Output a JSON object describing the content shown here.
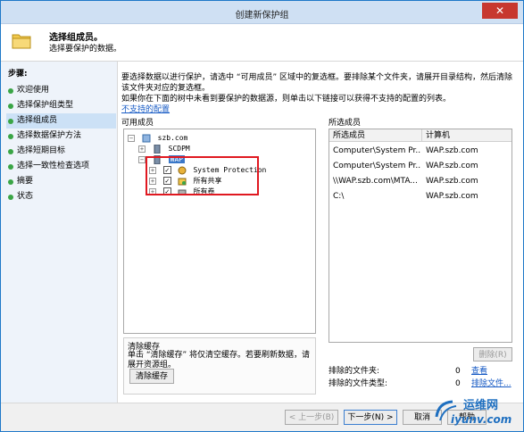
{
  "window": {
    "title": "创建新保护组",
    "close_glyph": "✕"
  },
  "header": {
    "title": "选择组成员。",
    "subtitle": "选择要保护的数据。"
  },
  "nav": {
    "heading": "步骤:",
    "items": [
      {
        "label": "欢迎使用"
      },
      {
        "label": "选择保护组类型"
      },
      {
        "label": "选择组成员"
      },
      {
        "label": "选择数据保护方法"
      },
      {
        "label": "选择短期目标"
      },
      {
        "label": "选择一致性检查选项"
      },
      {
        "label": "摘要"
      },
      {
        "label": "状态"
      }
    ],
    "active_index": 2
  },
  "main": {
    "desc_line1": "要选择数据以进行保护，请选中 “可用成员” 区域中的复选框。要排除某个文件夹，请展开目录结构，然后清除",
    "desc_line2": "该文件夹对应的复选框。",
    "desc_line3": "如果你在下面的树中未看到要保护的数据源，则单击以下链接可以获得不支持的配置的列表。",
    "unsupported_link": "不支持的配置",
    "available_label": "可用成员",
    "selected_label": "所选成员",
    "tree": {
      "root": "szb.com",
      "children": [
        "SCDPM",
        "WAP"
      ],
      "wap_children": [
        "System Protection",
        "所有共享",
        "所有卷"
      ],
      "check_glyph": "✓"
    },
    "clear_cache": {
      "title": "清除缓存",
      "description": "单击 “清除缓存” 将仅清空缓存。若要刷新数据，请展开资源组。",
      "button": "清除缓存"
    },
    "selected_table": {
      "headers": [
        "所选成员",
        "计算机"
      ],
      "rows": [
        [
          "Computer\\System  Pr...",
          "WAP.szb.com"
        ],
        [
          "Computer\\System  Pr...",
          "WAP.szb.com"
        ],
        [
          "\\\\WAP.szb.com\\MTA...",
          "WAP.szb.com"
        ],
        [
          "C:\\",
          "WAP.szb.com"
        ]
      ]
    },
    "remove_button": "删除(R)",
    "excluded": [
      {
        "label": "排除的文件夹:",
        "count": "0",
        "link": "查看"
      },
      {
        "label": "排除的文件类型:",
        "count": "0",
        "link": "排除文件..."
      }
    ]
  },
  "footer": {
    "prev": "< 上一步(B)",
    "next": "下一步(N) >",
    "cancel": "取消",
    "help": "帮助"
  },
  "watermark": {
    "line1": "运维网",
    "line2": "iyunv.com"
  },
  "colors": {
    "accent": "#1e78c8",
    "link": "#1559c4",
    "highlight": "#e01820",
    "nav_bg": "#eef3fa"
  }
}
